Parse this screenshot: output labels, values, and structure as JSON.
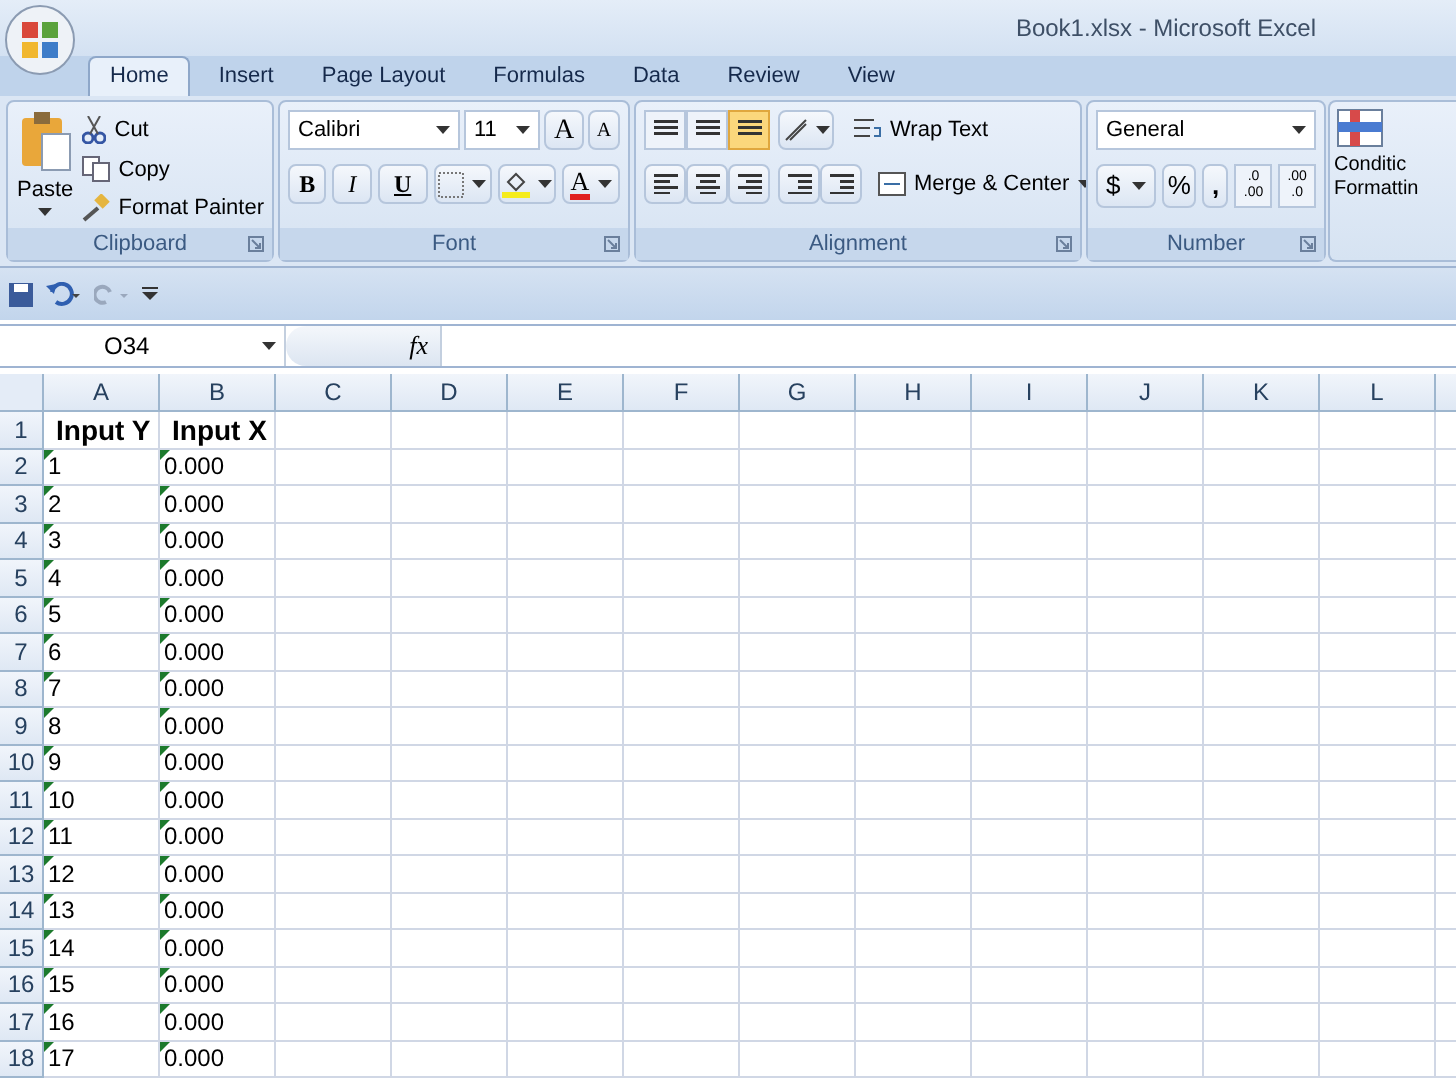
{
  "window": {
    "title": "Book1.xlsx - Microsoft Excel"
  },
  "tabs": [
    {
      "label": "Home",
      "selected": true
    },
    {
      "label": "Insert",
      "selected": false
    },
    {
      "label": "Page Layout",
      "selected": false
    },
    {
      "label": "Formulas",
      "selected": false
    },
    {
      "label": "Data",
      "selected": false
    },
    {
      "label": "Review",
      "selected": false
    },
    {
      "label": "View",
      "selected": false
    }
  ],
  "clipboard": {
    "label": "Clipboard",
    "paste": "Paste",
    "cut": "Cut",
    "copy": "Copy",
    "format_painter": "Format Painter"
  },
  "font": {
    "label": "Font",
    "family": "Calibri",
    "size": "11",
    "grow": "A",
    "shrink": "A",
    "bold": "B",
    "italic": "I",
    "underline": "U",
    "font_color": "A"
  },
  "alignment": {
    "label": "Alignment",
    "wrap_text": "Wrap Text",
    "merge_center": "Merge & Center",
    "vertical": [
      {
        "selected": false
      },
      {
        "selected": false
      },
      {
        "selected": true
      }
    ]
  },
  "number": {
    "label": "Number",
    "format": "General",
    "currency": "$",
    "percent": "%",
    "comma": ",",
    "increase_decimal": [
      ".0",
      ".00"
    ],
    "decrease_decimal": [
      ".00",
      ".0"
    ]
  },
  "styles": {
    "conditional_formatting": [
      "Conditic",
      "Formattin"
    ]
  },
  "formula_bar": {
    "name_box": "O34",
    "function_label": "fx"
  },
  "sheet": {
    "columns": [
      "A",
      "B",
      "C",
      "D",
      "E",
      "F",
      "G",
      "H",
      "I",
      "J",
      "K",
      "L"
    ],
    "rows": [
      {
        "number": "1",
        "kind": "header",
        "flagged": false,
        "cells": [
          "Input Y",
          "Input X"
        ]
      },
      {
        "number": "2",
        "kind": "data",
        "flagged": true,
        "cells": [
          "1",
          "0.000"
        ]
      },
      {
        "number": "3",
        "kind": "data",
        "flagged": true,
        "cells": [
          "2",
          "0.000"
        ]
      },
      {
        "number": "4",
        "kind": "data",
        "flagged": true,
        "cells": [
          "3",
          "0.000"
        ]
      },
      {
        "number": "5",
        "kind": "data",
        "flagged": true,
        "cells": [
          "4",
          "0.000"
        ]
      },
      {
        "number": "6",
        "kind": "data",
        "flagged": true,
        "cells": [
          "5",
          "0.000"
        ]
      },
      {
        "number": "7",
        "kind": "data",
        "flagged": true,
        "cells": [
          "6",
          "0.000"
        ]
      },
      {
        "number": "8",
        "kind": "data",
        "flagged": true,
        "cells": [
          "7",
          "0.000"
        ]
      },
      {
        "number": "9",
        "kind": "data",
        "flagged": true,
        "cells": [
          "8",
          "0.000"
        ]
      },
      {
        "number": "10",
        "kind": "data",
        "flagged": true,
        "cells": [
          "9",
          "0.000"
        ]
      },
      {
        "number": "11",
        "kind": "data",
        "flagged": true,
        "cells": [
          "10",
          "0.000"
        ]
      },
      {
        "number": "12",
        "kind": "data",
        "flagged": true,
        "cells": [
          "11",
          "0.000"
        ]
      },
      {
        "number": "13",
        "kind": "data",
        "flagged": true,
        "cells": [
          "12",
          "0.000"
        ]
      },
      {
        "number": "14",
        "kind": "data",
        "flagged": true,
        "cells": [
          "13",
          "0.000"
        ]
      },
      {
        "number": "15",
        "kind": "data",
        "flagged": true,
        "cells": [
          "14",
          "0.000"
        ]
      },
      {
        "number": "16",
        "kind": "data",
        "flagged": true,
        "cells": [
          "15",
          "0.000"
        ]
      },
      {
        "number": "17",
        "kind": "data",
        "flagged": true,
        "cells": [
          "16",
          "0.000"
        ]
      },
      {
        "number": "18",
        "kind": "data",
        "flagged": true,
        "cells": [
          "17",
          "0.000"
        ]
      }
    ]
  }
}
